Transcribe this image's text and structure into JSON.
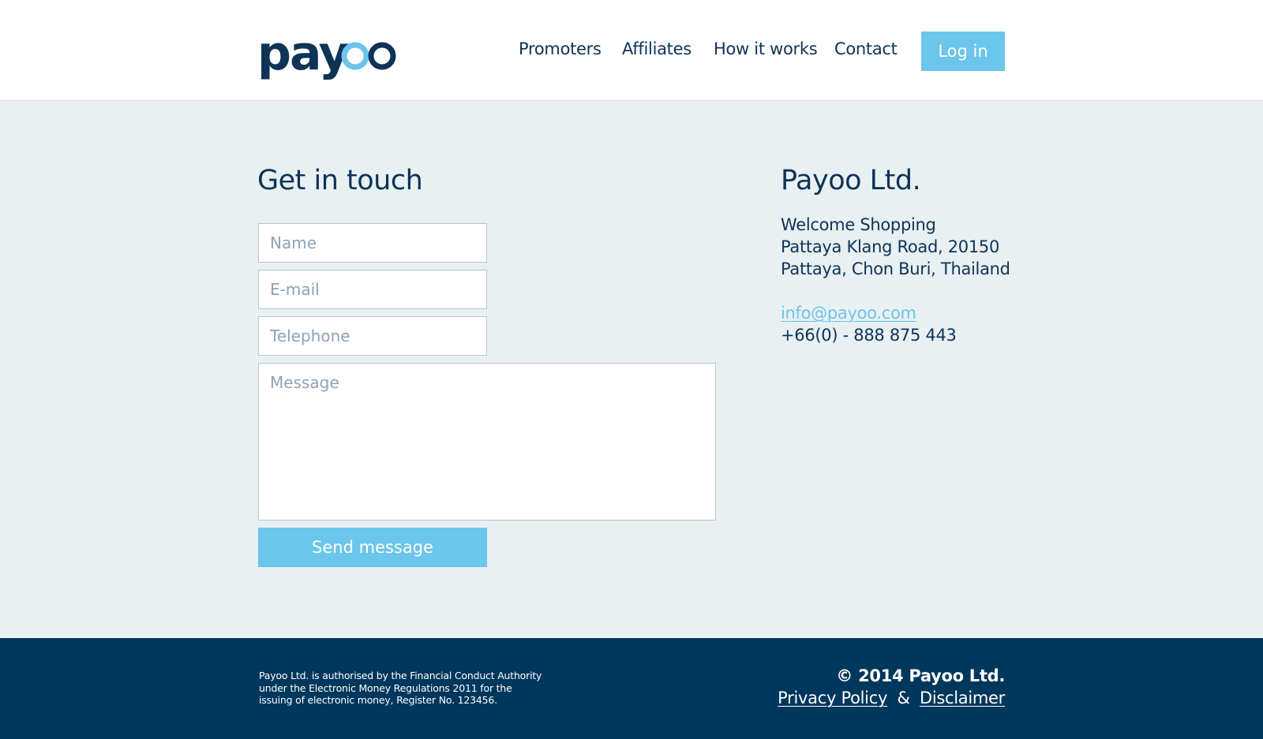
{
  "brand": {
    "logo_text": "payoo",
    "primary_color": "#0d3357",
    "accent_color": "#6cc5ea",
    "footer_color": "#00375c"
  },
  "nav": {
    "items": [
      {
        "label": "Promoters"
      },
      {
        "label": "Affiliates"
      },
      {
        "label": "How it works"
      },
      {
        "label": "Contact"
      }
    ],
    "login_label": "Log in"
  },
  "contact_form": {
    "title": "Get in touch",
    "name_placeholder": "Name",
    "email_placeholder": "E-mail",
    "telephone_placeholder": "Telephone",
    "message_placeholder": "Message",
    "submit_label": "Send message"
  },
  "company": {
    "name": "Payoo Ltd.",
    "address": [
      "Welcome Shopping",
      "Pattaya Klang Road, 20150",
      "Pattaya, Chon Buri, Thailand"
    ],
    "email": "info@payoo.com",
    "phone": "+66(0) - 888 875 443"
  },
  "footer": {
    "legal": "Payoo Ltd. is authorised by the Financial Conduct Authority under the Electronic Money Regulations 2011 for the issuing of electronic money, Register No. 123456.",
    "copyright": "© 2014 Payoo Ltd.",
    "privacy_label": "Privacy Policy",
    "separator": "&",
    "disclaimer_label": "Disclaimer"
  }
}
